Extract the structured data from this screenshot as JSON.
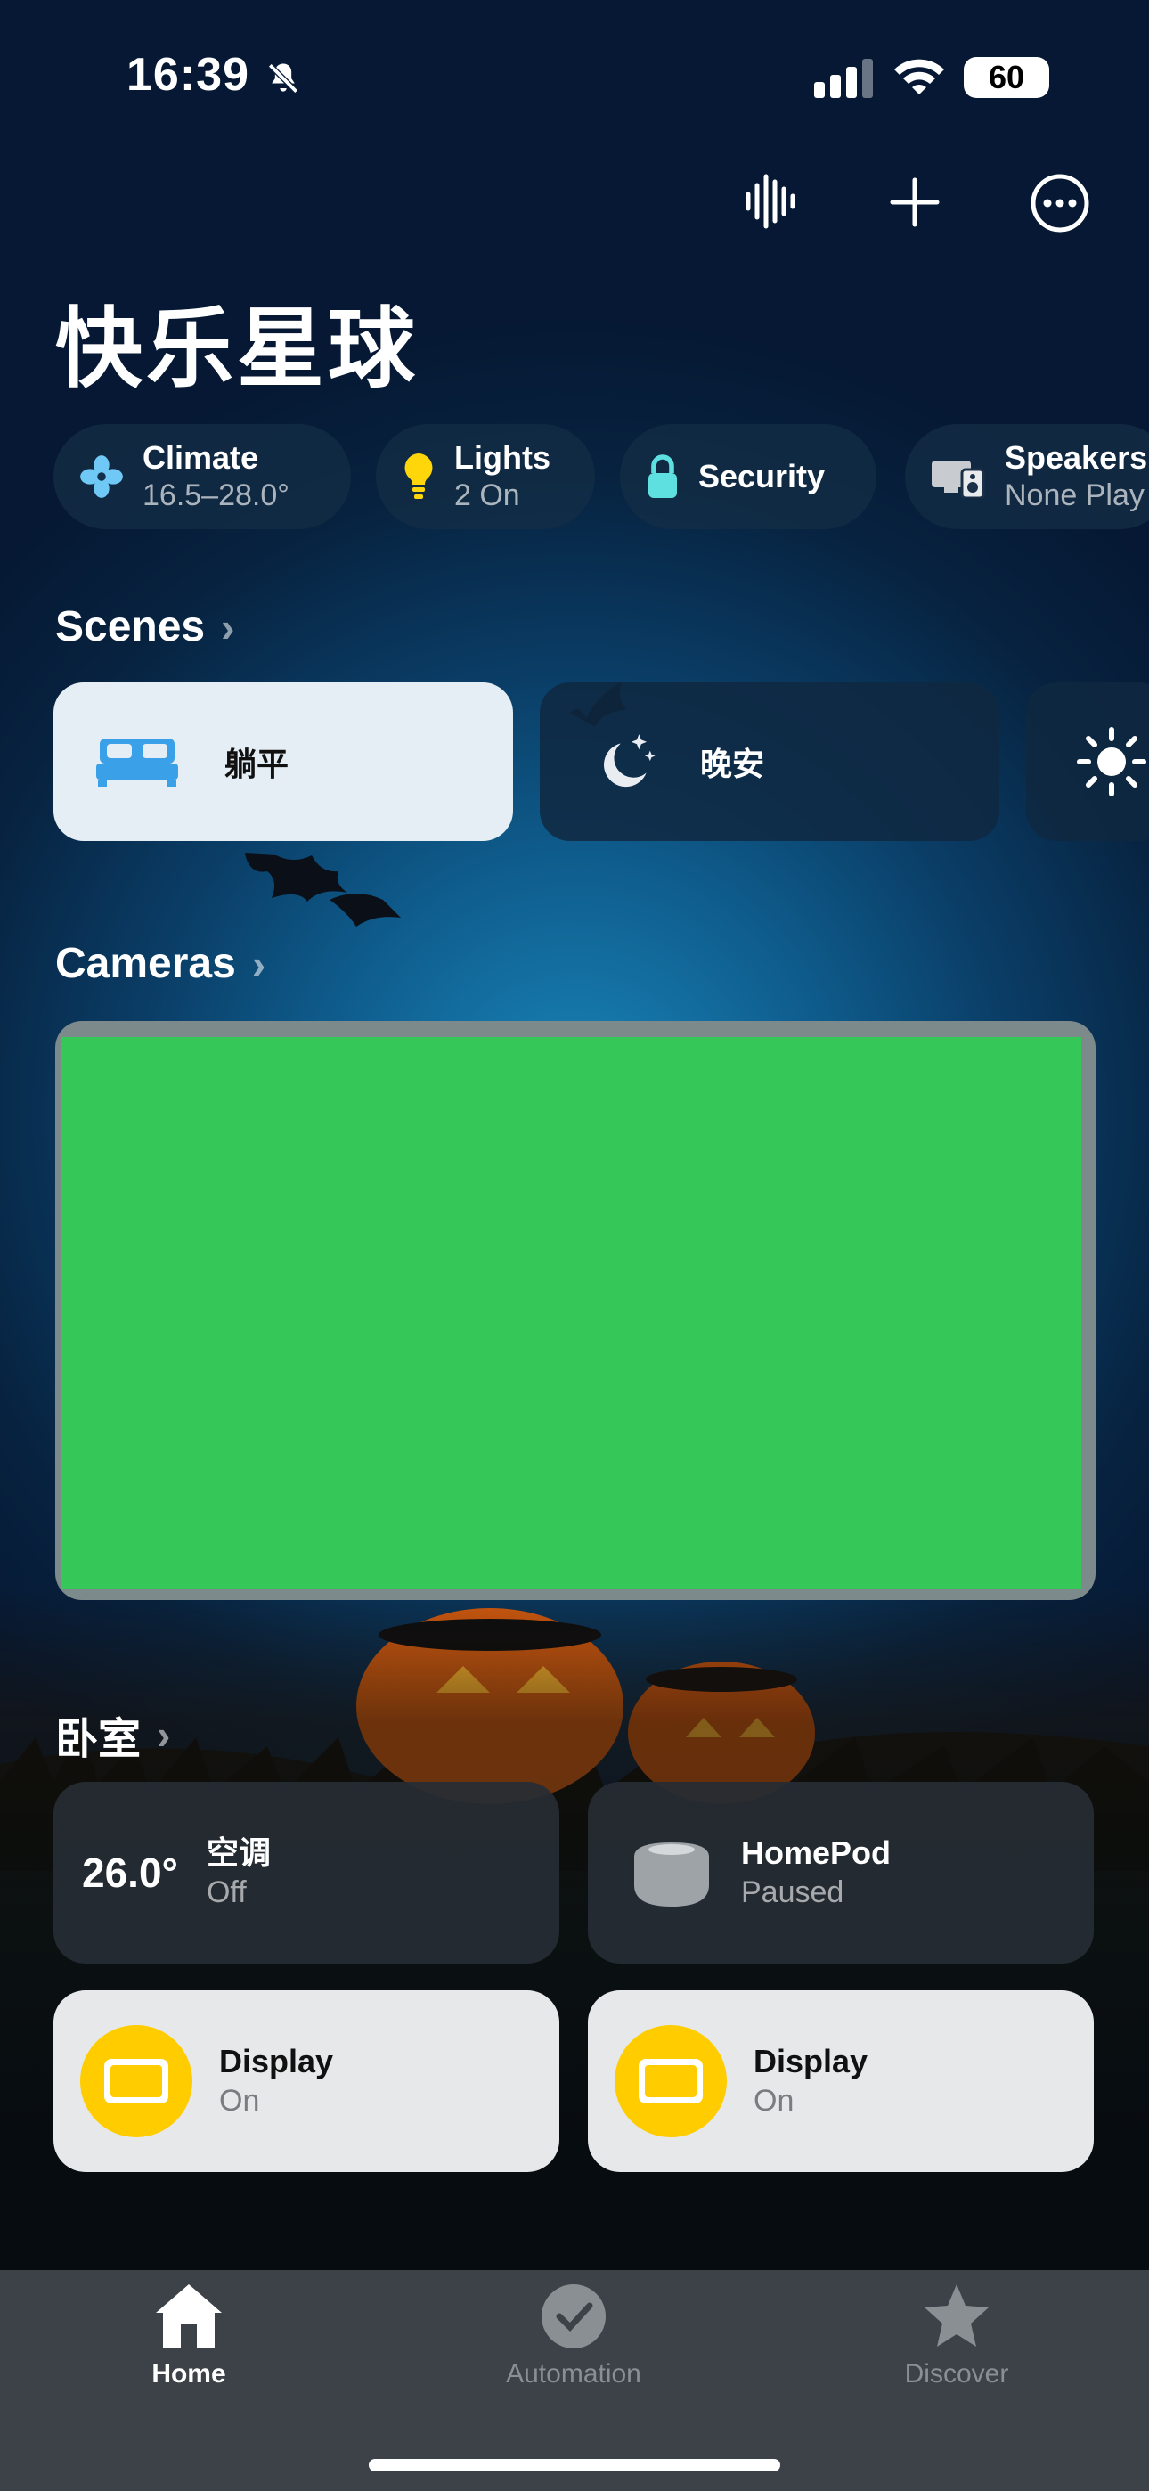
{
  "status_bar": {
    "time": "16:39",
    "battery": "60"
  },
  "header": {
    "title": "快乐星球"
  },
  "categories": [
    {
      "label": "Climate",
      "value": "16.5–28.0°",
      "icon": "fan-icon"
    },
    {
      "label": "Lights",
      "value": "2 On",
      "icon": "lightbulb-icon"
    },
    {
      "label": "Security",
      "value": "",
      "icon": "lock-icon"
    },
    {
      "label": "Speakers",
      "value": "None Play",
      "icon": "speakers-icon"
    }
  ],
  "scenes": {
    "title": "Scenes",
    "items": [
      {
        "label": "躺平",
        "icon": "bed-icon",
        "active": true
      },
      {
        "label": "晚安",
        "icon": "moon-stars-icon",
        "active": false
      },
      {
        "label": "",
        "icon": "sun-icon",
        "active": false
      }
    ]
  },
  "cameras": {
    "title": "Cameras"
  },
  "room": {
    "title": "卧室",
    "tiles": [
      {
        "reading": "26.0°",
        "name": "空调",
        "state": "Off"
      },
      {
        "name": "HomePod",
        "state": "Paused"
      },
      {
        "name": "Display",
        "state": "On"
      },
      {
        "name": "Display",
        "state": "On"
      }
    ]
  },
  "tabs": [
    {
      "label": "Home",
      "active": true
    },
    {
      "label": "Automation",
      "active": false
    },
    {
      "label": "Discover",
      "active": false
    }
  ],
  "colors": {
    "accent_yellow": "#ffcc00",
    "camera_green": "#36c759",
    "tile_light": "#e6e8ea"
  }
}
